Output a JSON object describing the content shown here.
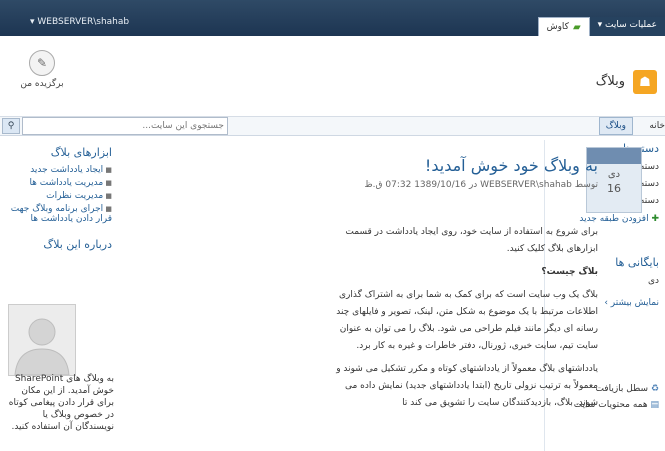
{
  "topbar": {
    "user_menu": "▾ WEBSERVER\\shahab",
    "tab_site_actions": "عملیات سایت ▾",
    "tab_browse": "کاوش"
  },
  "ribbon": {
    "favorite_label": "برگزیده من"
  },
  "site": {
    "title": "وبلاگ"
  },
  "search": {
    "placeholder": "جستجوی این سایت..."
  },
  "nav": {
    "home": "خانه",
    "blog": "وبلاگ"
  },
  "right": {
    "categories_head": "دسته ها",
    "categories": [
      "دسته 1",
      "دسته 2",
      "دسته 3"
    ],
    "add_category": "افزودن طبقه جدید",
    "archives_head": "بایگانی ها",
    "archives_item": "دی",
    "show_more": "نمایش بیشتر ›",
    "recycle": "سطل بازیافت",
    "all_content": "همه محتویات سایت"
  },
  "left": {
    "tools_head": "ابزارهای بلاگ",
    "tools": [
      "ایجاد یادداشت جدید",
      "مدیریت یادداشت ها",
      "مدیریت نظرات",
      "اجرای برنامه وبلاگ جهت قرار دادن یادداشت ها"
    ],
    "about_head": "درباره این بلاگ",
    "about_text": "به وبلاگ های SharePoint خوش آمدید. از این مکان برای قرار دادن پیغامی کوتاه در خصوص وبلاگ یا نویسندگان آن استفاده کنید."
  },
  "post": {
    "date_month": "دی",
    "date_day": "16",
    "title": "به وبلاگ خود خوش آمدید!",
    "meta": "توسط WEBSERVER\\shahab در 1389/10/16 07:32 ق.ظ",
    "p1": "برای شروع به استفاده از سایت خود، روی ایجاد یادداشت در قسمت ابزارهای بلاگ کلیک کنید.",
    "question": "بلاگ چیست؟",
    "p2": "بلاگ یک وب سایت است که برای کمک به شما برای به اشتراک گذاری اطلاعات مرتبط با یک موضوع به شکل متن، لینک، تصویر و فایلهای چند رسانه ای دیگر مانند فیلم طراحی می شود. بلاگ را می توان به عنوان سایت تیم، سایت خبری، ژورنال، دفتر خاطرات و غیره به کار برد.",
    "p3": "یادداشتهای بلاگ معمولاً از یادداشتهای کوتاه و مکرر تشکیل می شوند و معمولاً به ترتیب نزولی تاریخ (ابتدا یادداشتهای جدید) نمایش داده می شوند. بلاگ، بازدیدکنندگان سایت را تشویق می کند تا"
  }
}
